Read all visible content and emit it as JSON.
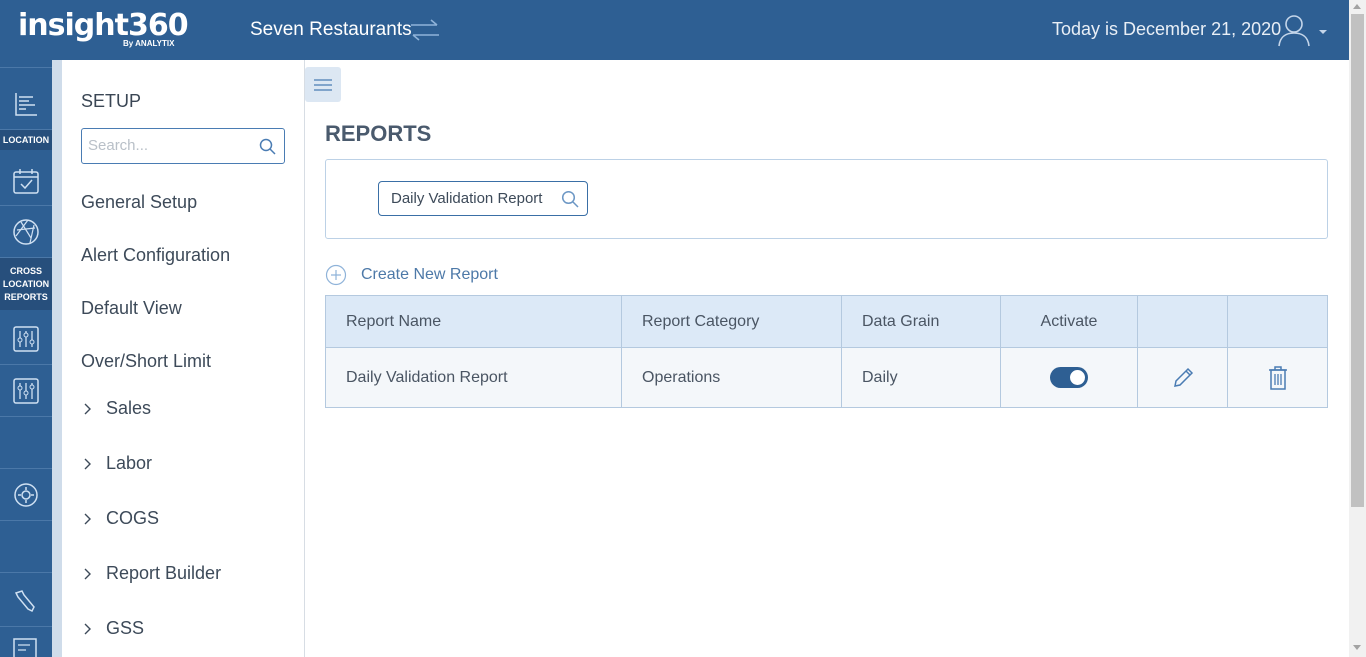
{
  "header": {
    "logo_main": "insight360",
    "logo_sub": "By ANALYTIX",
    "company": "Seven Restaurants",
    "today": "Today is December 21, 2020"
  },
  "rail": {
    "location_label": "LOCATION",
    "cross_location_label_1": "CROSS",
    "cross_location_label_2": "LOCATION",
    "cross_location_label_3": "REPORTS"
  },
  "setup": {
    "title": "SETUP",
    "search_placeholder": "Search...",
    "items": [
      "General Setup",
      "Alert Configuration",
      "Default View",
      "Over/Short Limit"
    ],
    "expandable": [
      "Sales",
      "Labor",
      "COGS",
      "Report Builder",
      "GSS"
    ]
  },
  "main": {
    "title": "REPORTS",
    "search_value": "Daily Validation Report",
    "create_label": "Create New Report",
    "columns": [
      "Report Name",
      "Report Category",
      "Data Grain",
      "Activate"
    ],
    "rows": [
      {
        "name": "Daily Validation Report",
        "category": "Operations",
        "grain": "Daily",
        "active": true
      }
    ]
  },
  "colors": {
    "brand": "#2e5f93",
    "table_header": "#dce9f7",
    "accent_link": "#4d79a8"
  }
}
